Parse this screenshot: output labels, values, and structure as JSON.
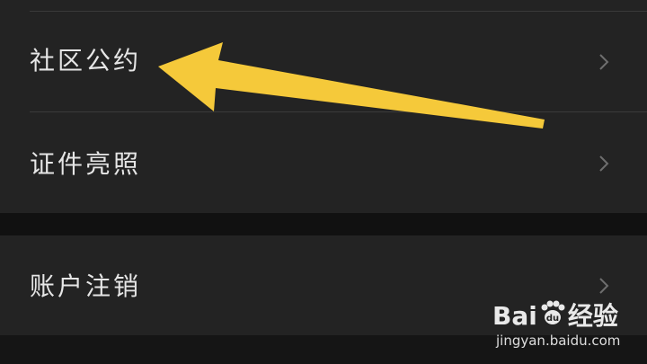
{
  "settings": {
    "items": [
      {
        "label": "社区公约"
      },
      {
        "label": "证件亮照"
      },
      {
        "label": "账户注销"
      }
    ]
  },
  "annotation": {
    "arrow_color": "#F5C93A"
  },
  "watermark": {
    "logo_text_left": "Bai",
    "logo_text_right": "经验",
    "url": "jingyan.baidu.com"
  },
  "colors": {
    "background": "#111111",
    "panel": "#232323",
    "text": "#E6E6E6",
    "chevron": "#6E6E6E"
  }
}
